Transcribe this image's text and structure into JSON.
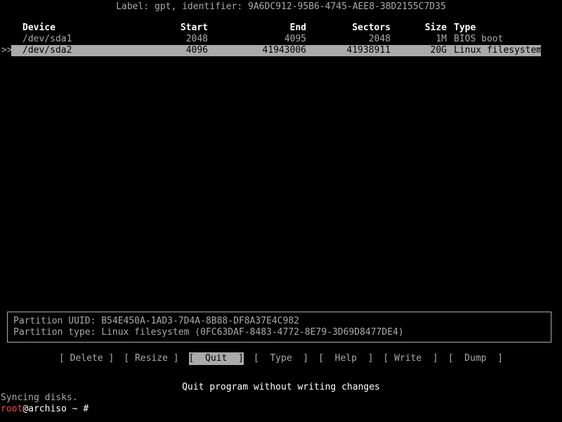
{
  "terminal": {
    "background": "#000000",
    "foreground": "#aaaaaa",
    "bright_foreground": "#ffffff",
    "highlight_background": "#aaaaaa",
    "highlight_foreground": "#000000",
    "prompt_user_color": "#ef4b4b"
  },
  "disk": {
    "label_line": "Label: gpt, identifier: 9A6DC912-95B6-4745-AEE8-38D2155C7D35",
    "label_type": "gpt",
    "identifier": "9A6DC912-95B6-4745-AEE8-38D2155C7D35"
  },
  "table": {
    "headers": {
      "device": "Device",
      "start": "Start",
      "end": "End",
      "sectors": "Sectors",
      "size": "Size",
      "type": "Type"
    },
    "rows": [
      {
        "marker": "",
        "device": "/dev/sda1",
        "start": "2048",
        "end": "4095",
        "sectors": "2048",
        "size": "1M",
        "type": "BIOS boot",
        "selected": false
      },
      {
        "marker": ">>",
        "device": "/dev/sda2",
        "start": "4096",
        "end": "41943006",
        "sectors": "41938911",
        "size": "20G",
        "type": "Linux filesystem",
        "selected": true
      }
    ]
  },
  "info": {
    "uuid_label": "Partition UUID:",
    "uuid_value": "B54E450A-1AD3-7D4A-8B88-DF8A37E4C982",
    "uuid_line": "Partition UUID: B54E450A-1AD3-7D4A-8B88-DF8A37E4C982",
    "type_label": "Partition type:",
    "type_value": "Linux filesystem (0FC63DAF-8483-4772-8E79-3D69D8477DE4)",
    "type_line": "Partition type: Linux filesystem (0FC63DAF-8483-4772-8E79-3D69D8477DE4)"
  },
  "menu": {
    "items": [
      {
        "label": "[ Delete ]",
        "name": "delete",
        "selected": false
      },
      {
        "label": "[ Resize ]",
        "name": "resize",
        "selected": false
      },
      {
        "label": "[  Quit  ]",
        "name": "quit",
        "selected": true
      },
      {
        "label": "[  Type  ]",
        "name": "type",
        "selected": false
      },
      {
        "label": "[  Help  ]",
        "name": "help",
        "selected": false
      },
      {
        "label": "[ Write  ]",
        "name": "write",
        "selected": false
      },
      {
        "label": "[  Dump  ]",
        "name": "dump",
        "selected": false
      }
    ],
    "hint": "Quit program without writing changes"
  },
  "shell": {
    "sync_message": "Syncing disks.",
    "prompt_user": "root",
    "prompt_rest": "@archiso ~ #"
  }
}
